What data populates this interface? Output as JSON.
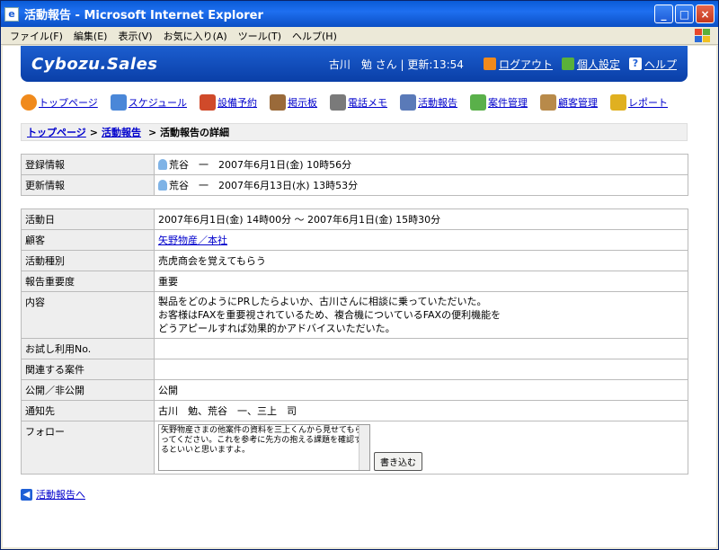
{
  "window": {
    "title": "活動報告 - Microsoft Internet Explorer"
  },
  "menu": [
    "ファイル(F)",
    "編集(E)",
    "表示(V)",
    "お気に入り(A)",
    "ツール(T)",
    "ヘルプ(H)"
  ],
  "header": {
    "logo": "Cybozu.Sales",
    "user_info": "古川　勉 さん | 更新:13:54",
    "logout": "ログアウト",
    "settings": "個人設定",
    "help": "ヘルプ"
  },
  "nav": [
    {
      "label": "トップページ",
      "icon": "top-icon",
      "color": "#f08a1c"
    },
    {
      "label": "スケジュール",
      "icon": "schedule-icon",
      "color": "#4a87d8"
    },
    {
      "label": "設備予約",
      "icon": "chair-icon",
      "color": "#d04a2a"
    },
    {
      "label": "掲示板",
      "icon": "board-icon",
      "color": "#9a6a3a"
    },
    {
      "label": "電話メモ",
      "icon": "phone-icon",
      "color": "#7a7a7a"
    },
    {
      "label": "活動報告",
      "icon": "report-icon",
      "color": "#5a7ab8"
    },
    {
      "label": "案件管理",
      "icon": "case-icon",
      "color": "#5ab04a"
    },
    {
      "label": "顧客管理",
      "icon": "customer-icon",
      "color": "#b88a4a"
    },
    {
      "label": "レポート",
      "icon": "chart-icon",
      "color": "#e0b020"
    }
  ],
  "breadcrumb": {
    "top": "トップページ",
    "reports": "活動報告",
    "current": "> 活動報告の詳細"
  },
  "meta": {
    "registered_label": "登録情報",
    "registered": "荒谷　一　2007年6月1日(金) 10時56分",
    "updated_label": "更新情報",
    "updated": "荒谷　一　2007年6月13日(水) 13時53分"
  },
  "details": {
    "date_label": "活動日",
    "date": "2007年6月1日(金) 14時00分 〜 2007年6月1日(金) 15時30分",
    "customer_label": "顧客",
    "customer": "矢野物産／本社",
    "type_label": "活動種別",
    "type": "売虎商会を覚えてもらう",
    "importance_label": "報告重要度",
    "importance": "重要",
    "content_label": "内容",
    "content_1": "製品をどのようにPRしたらよいか、古川さんに相談に乗っていただいた。",
    "content_2": "お客様はFAXを重要視されているため、複合機についているFAXの便利機能を",
    "content_3": "どうアピールすれば効果的かアドバイスいただいた。",
    "trial_label": "お試し利用No.",
    "trial": "",
    "related_label": "関連する案件",
    "related": "",
    "public_label": "公開／非公開",
    "public": "公開",
    "notify_label": "通知先",
    "notify": "古川　勉、荒谷　一、三上　司",
    "follow_label": "フォロー",
    "follow_text": "矢野物産さまの他案件の資料を三上くんから見せてもらってください。これを参考に先方の抱える課題を確認するといいと思いますよ。",
    "write_button": "書き込む"
  },
  "back": "活動報告へ"
}
